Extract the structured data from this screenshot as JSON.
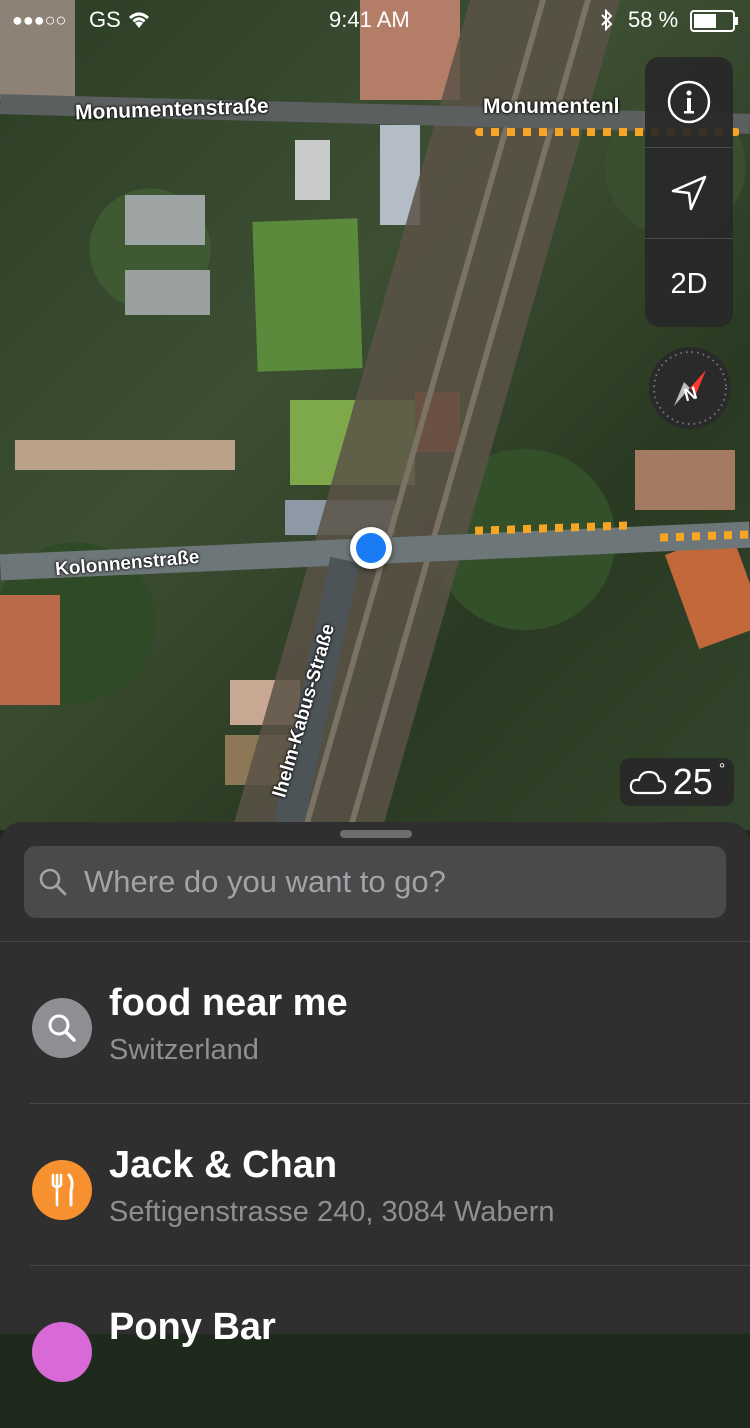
{
  "status_bar": {
    "signal": "●●●○○",
    "carrier": "GS",
    "time": "9:41 AM",
    "battery": "58 %"
  },
  "map": {
    "roads": [
      "Monumentenstraße",
      "Monumentenl",
      "Kolonnenstraße",
      "lhelm-Kabus-Straße"
    ],
    "controls": {
      "mode_label": "2D"
    },
    "compass_label": "N",
    "weather": {
      "temp": "25",
      "degree": "°"
    }
  },
  "search": {
    "placeholder": "Where do you want to go?"
  },
  "results": [
    {
      "title": "food near me",
      "subtitle": "Switzerland",
      "icon": "search-icon",
      "color": "#8e8e93"
    },
    {
      "title": "Jack & Chan",
      "subtitle": "Seftigenstrasse 240, 3084 Wabern",
      "icon": "fork-knife-icon",
      "color": "#f7902f"
    },
    {
      "title": "Pony Bar",
      "subtitle": "",
      "icon": "bar-icon",
      "color": "#d86ad8"
    }
  ]
}
